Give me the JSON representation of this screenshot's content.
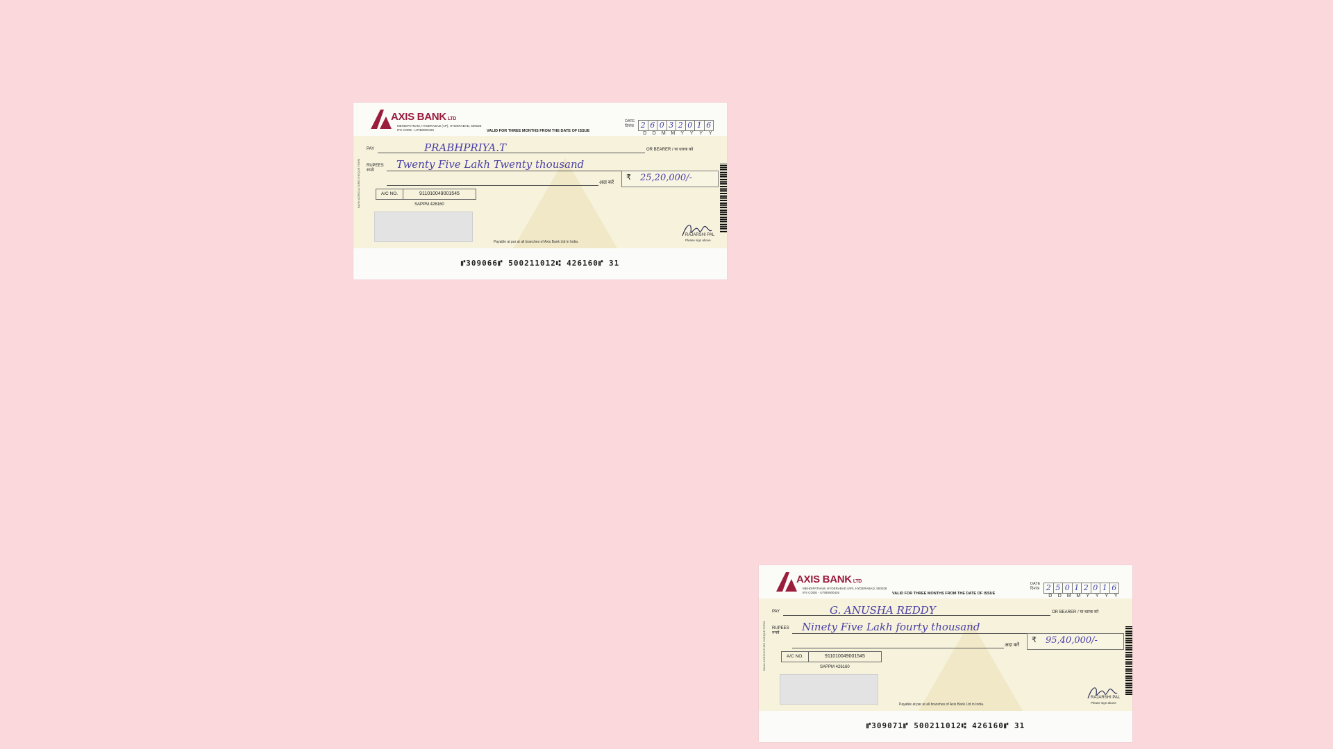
{
  "colors": {
    "background": "#fad8dc",
    "cheque_paper": "#f6f2dc",
    "bank_brand": "#9a1d3c",
    "ink": "#4a3fa6"
  },
  "cheques": [
    {
      "bank_name": "AXIS BANK",
      "bank_suffix": "LTD",
      "branch_address": "MEHDIPATNAM, HYDERABAD (AP), HYDERABAD, 500028",
      "ifs_code": "IFS CODE - UTIB0000426",
      "validity": "VALID FOR THREE MONTHS FROM THE DATE OF ISSUE",
      "date_label": "DATE",
      "date_label_hindi": "दिनांक",
      "date_digits": [
        "2",
        "6",
        "0",
        "3",
        "2",
        "0",
        "1",
        "6"
      ],
      "date_format": [
        "D",
        "D",
        "M",
        "M",
        "Y",
        "Y",
        "Y",
        "Y"
      ],
      "pay_label": "PAY",
      "payee": "PRABHPRIYA.T",
      "bearer_label": "OR BEARER / या धारक को",
      "rupees_label": "RUPEES",
      "rupees_label_hindi": "रुपये",
      "amount_words": "Twenty Five Lakh Twenty thousand",
      "ada_kare": "अदा करें",
      "rupee_symbol": "₹",
      "amount_figures": "25,20,000/-",
      "acno_label": "A/C NO.",
      "account_number": "911010049001545",
      "sappm": "SAPPM     426160",
      "payable_text": "Payable at par at all branches of Axis Bank Ltd in India.",
      "signatory_name": "RAJARSHI PAL",
      "signatory_note": "Please sign above",
      "micr_line": "⑈309066⑈  500211012⑆  426160⑈  31",
      "side_text": "BANK AGRICULTURE CHEQUE FORM"
    },
    {
      "bank_name": "AXIS BANK",
      "bank_suffix": "LTD",
      "branch_address": "MEHDIPATNAM, HYDERABAD (AP), HYDERABAD, 500028",
      "ifs_code": "IFS CODE - UTIB0000426",
      "validity": "VALID FOR THREE MONTHS FROM THE DATE OF ISSUE",
      "date_label": "DATE",
      "date_label_hindi": "दिनांक",
      "date_digits": [
        "2",
        "5",
        "0",
        "1",
        "2",
        "0",
        "1",
        "6"
      ],
      "date_format": [
        "D",
        "D",
        "M",
        "M",
        "Y",
        "Y",
        "Y",
        "Y"
      ],
      "pay_label": "PAY",
      "payee": "G. ANUSHA REDDY",
      "bearer_label": "OR BEARER / या धारक को",
      "rupees_label": "RUPEES",
      "rupees_label_hindi": "रुपये",
      "amount_words": "Ninety Five Lakh fourty thousand",
      "ada_kare": "अदा करें",
      "rupee_symbol": "₹",
      "amount_figures": "95,40,000/-",
      "acno_label": "A/C NO.",
      "account_number": "911010049001545",
      "sappm": "SAPPM     426160",
      "payable_text": "Payable at par at all branches of Axis Bank Ltd in India.",
      "signatory_name": "RAJARSHI PAL",
      "signatory_note": "Please sign above",
      "micr_line": "⑈309071⑈  500211012⑆  426160⑈  31",
      "side_text": "BANK AGRICULTURE CHEQUE FORM"
    }
  ]
}
